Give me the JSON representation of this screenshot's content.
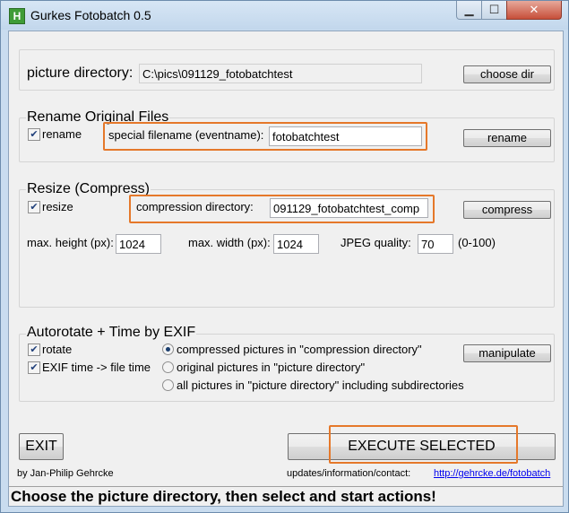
{
  "window": {
    "title": "Gurkes Fotobatch 0.5",
    "app_icon_letter": "H",
    "minimize_glyph": "▁",
    "maximize_glyph": "☐",
    "close_glyph": "✕"
  },
  "picture_dir": {
    "label": "picture directory:",
    "value": "C:\\pics\\091129_fotobatchtest",
    "button": "choose dir"
  },
  "rename": {
    "group_title": "Rename Original Files",
    "checkbox_label": "rename",
    "checked": true,
    "field_label": "special filename (eventname):",
    "field_value": "fotobatchtest",
    "button": "rename"
  },
  "resize": {
    "group_title": "Resize (Compress)",
    "checkbox_label": "resize",
    "checked": true,
    "dir_label": "compression directory:",
    "dir_value": "091129_fotobatchtest_comp",
    "button": "compress",
    "max_height_label": "max. height (px):",
    "max_height_value": "1024",
    "max_width_label": "max. width (px):",
    "max_width_value": "1024",
    "jpeg_label": "JPEG quality:",
    "jpeg_value": "70",
    "jpeg_range": "(0-100)"
  },
  "exif": {
    "group_title": "Autorotate + Time by EXIF",
    "rotate_label": "rotate",
    "rotate_checked": true,
    "exiftime_label": "EXIF time -> file time",
    "exiftime_checked": true,
    "radio_options": [
      "compressed pictures in \"compression directory\"",
      "original pictures in \"picture directory\"",
      "all pictures in \"picture directory\" including subdirectories"
    ],
    "selected_index": 0,
    "button": "manipulate"
  },
  "footer": {
    "exit_button": "EXIT",
    "execute_button": "EXECUTE SELECTED",
    "author": "by Jan-Philip Gehrcke",
    "contact_label": "updates/information/contact:",
    "url": "http://gehrcke.de/fotobatch"
  },
  "status_text": "Choose the picture directory, then select and start actions!",
  "colors": {
    "highlight_border": "#e5782a",
    "checkmark": "#1f3f7a"
  }
}
